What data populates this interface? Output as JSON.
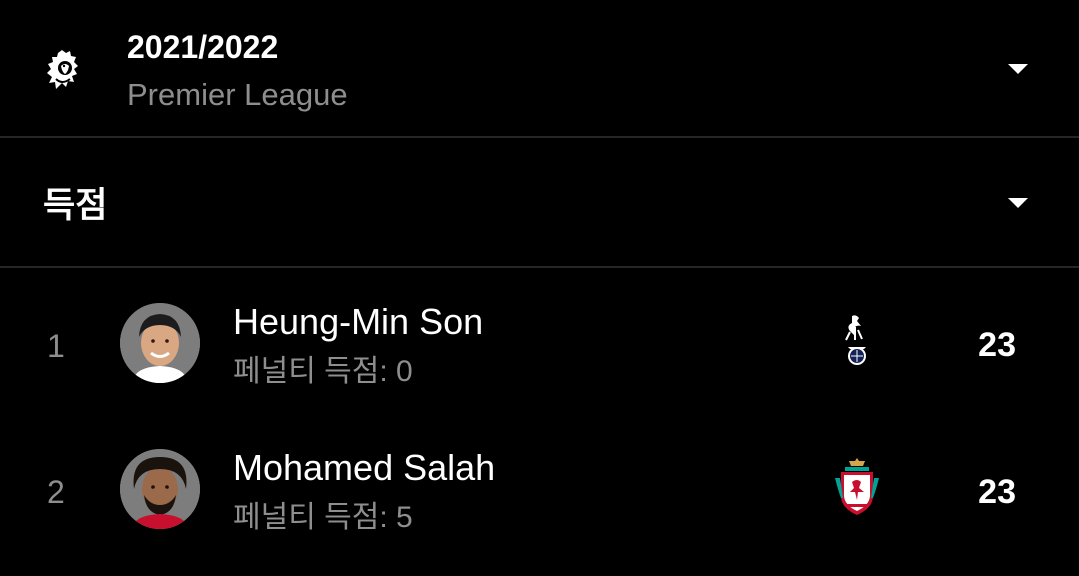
{
  "season": {
    "year": "2021/2022",
    "league": "Premier League",
    "logo_icon": "premier-league-lion-icon",
    "dropdown_icon": "caret-down-icon"
  },
  "stat": {
    "label": "득점",
    "dropdown_icon": "caret-down-icon"
  },
  "players": [
    {
      "rank": "1",
      "name": "Heung-Min Son",
      "penalty_text": "페널티 득점: 0",
      "club_icon": "tottenham-crest-icon",
      "goals": "23"
    },
    {
      "rank": "2",
      "name": "Mohamed Salah",
      "penalty_text": "페널티 득점: 5",
      "club_icon": "liverpool-crest-icon",
      "goals": "23"
    }
  ],
  "colors": {
    "background": "#000000",
    "primary_text": "#ffffff",
    "secondary_text": "#8e8e8e",
    "divider": "#262626",
    "spurs_navy": "#132257",
    "liverpool_red": "#c8102e"
  }
}
